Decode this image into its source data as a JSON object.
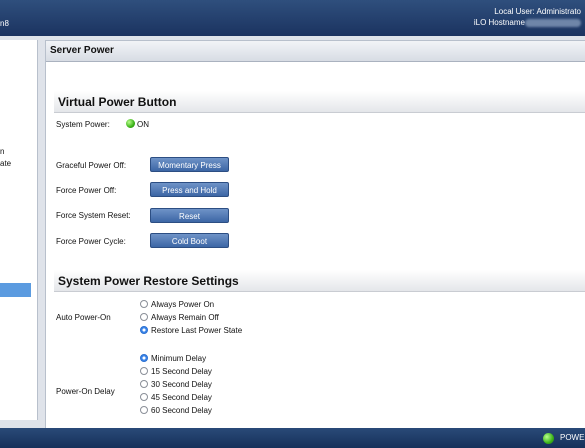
{
  "header": {
    "brand_fragment": "n8",
    "local_user": "Local User:  Administrato",
    "ilo_hostname_label": "iLO Hostname"
  },
  "sidebar": {
    "fragments": [
      "n",
      "ate"
    ]
  },
  "panel": {
    "title": "Server Power"
  },
  "virtual_power_button": {
    "title": "Virtual Power Button",
    "system_power_label": "System Power:",
    "system_power_status": "ON",
    "rows": [
      {
        "label": "Graceful Power Off:",
        "button": "Momentary Press"
      },
      {
        "label": "Force Power Off:",
        "button": "Press and Hold"
      },
      {
        "label": "Force System Reset:",
        "button": "Reset"
      },
      {
        "label": "Force Power Cycle:",
        "button": "Cold Boot"
      }
    ]
  },
  "restore_settings": {
    "title": "System Power Restore Settings",
    "auto_power_on": {
      "label": "Auto Power-On",
      "options": [
        "Always Power On",
        "Always Remain Off",
        "Restore Last Power State"
      ],
      "selected": "Restore Last Power State"
    },
    "power_on_delay": {
      "label": "Power-On Delay",
      "options": [
        "Minimum Delay",
        "15 Second Delay",
        "30 Second Delay",
        "45 Second Delay",
        "60 Second Delay"
      ],
      "selected": "Minimum Delay"
    }
  },
  "status_bar": {
    "power_label": "POWE",
    "led_color": "#3bb219"
  }
}
